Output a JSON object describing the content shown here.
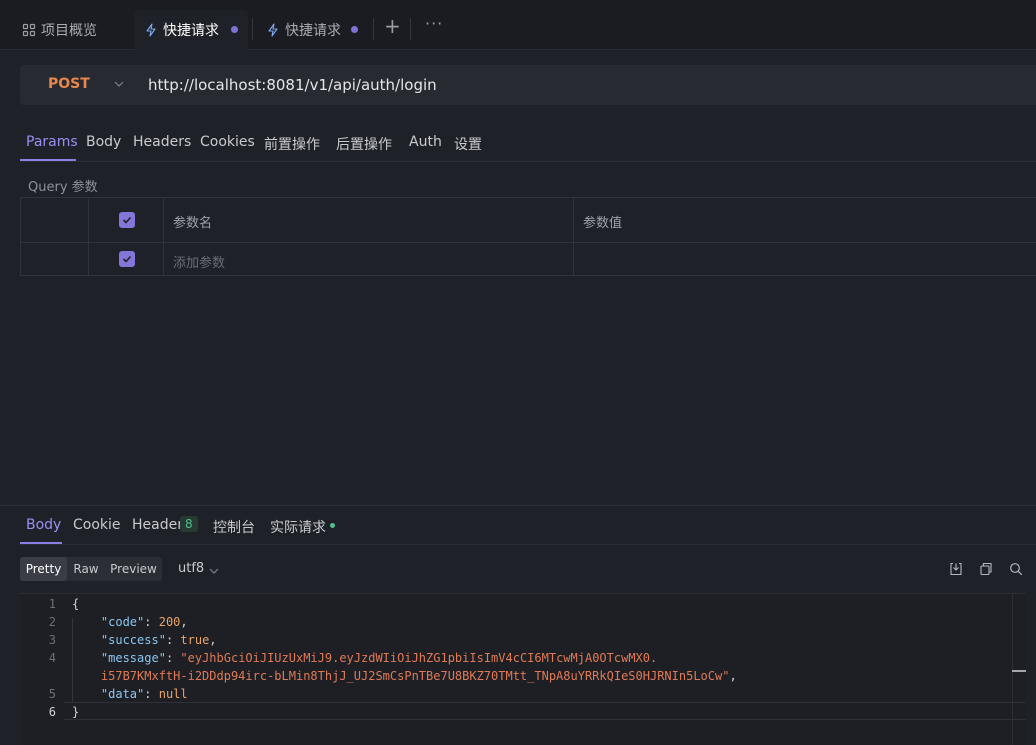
{
  "tabs": [
    {
      "label": "项目概览",
      "icon": "grid-icon"
    },
    {
      "label": "快捷请求",
      "icon": "lightning-icon",
      "active": true,
      "unsaved": true
    },
    {
      "label": "快捷请求",
      "icon": "lightning-icon",
      "unsaved": true
    }
  ],
  "tabbar": {
    "add_label": "+",
    "more_label": "···"
  },
  "request": {
    "method": "POST",
    "url": "http://localhost:8081/v1/api/auth/login"
  },
  "request_tabs": [
    "Params",
    "Body",
    "Headers",
    "Cookies",
    "前置操作",
    "后置操作",
    "Auth",
    "设置"
  ],
  "params": {
    "section_label": "Query 参数",
    "columns": [
      "参数名",
      "参数值"
    ],
    "add_placeholder": "添加参数"
  },
  "response_tabs": {
    "body": "Body",
    "cookie": "Cookie",
    "header": "Header",
    "header_count": "8",
    "console": "控制台",
    "actual_request": "实际请求"
  },
  "format_options": [
    "Pretty",
    "Raw",
    "Preview"
  ],
  "encoding": "utf8",
  "response_body": {
    "line_numbers": [
      "1",
      "2",
      "3",
      "4",
      "",
      "5",
      "6"
    ],
    "open_brace": "{",
    "close_brace": "}",
    "code_key": "\"code\"",
    "code_value": "200",
    "success_key": "\"success\"",
    "success_value": "true",
    "message_key": "\"message\"",
    "message_part1": "\"eyJhbGciOiJIUzUxMiJ9.eyJzdWIiOiJhZG1pbiIsImV4cCI6MTcwMjA0OTcwMX0.",
    "message_part2": "i57B7KMxftH-i2DDdp94irc-bLMin8ThjJ_UJ2SmCsPnTBe7U8BKZ70TMtt_TNpA8uYRRkQIeS0HJRNIn5LoCw\"",
    "data_key": "\"data\"",
    "data_value": "null"
  },
  "colors": {
    "accent": "#8b7fe6",
    "method": "#e8874b",
    "background": "#1f2128",
    "success_green": "#4fbf8f"
  }
}
